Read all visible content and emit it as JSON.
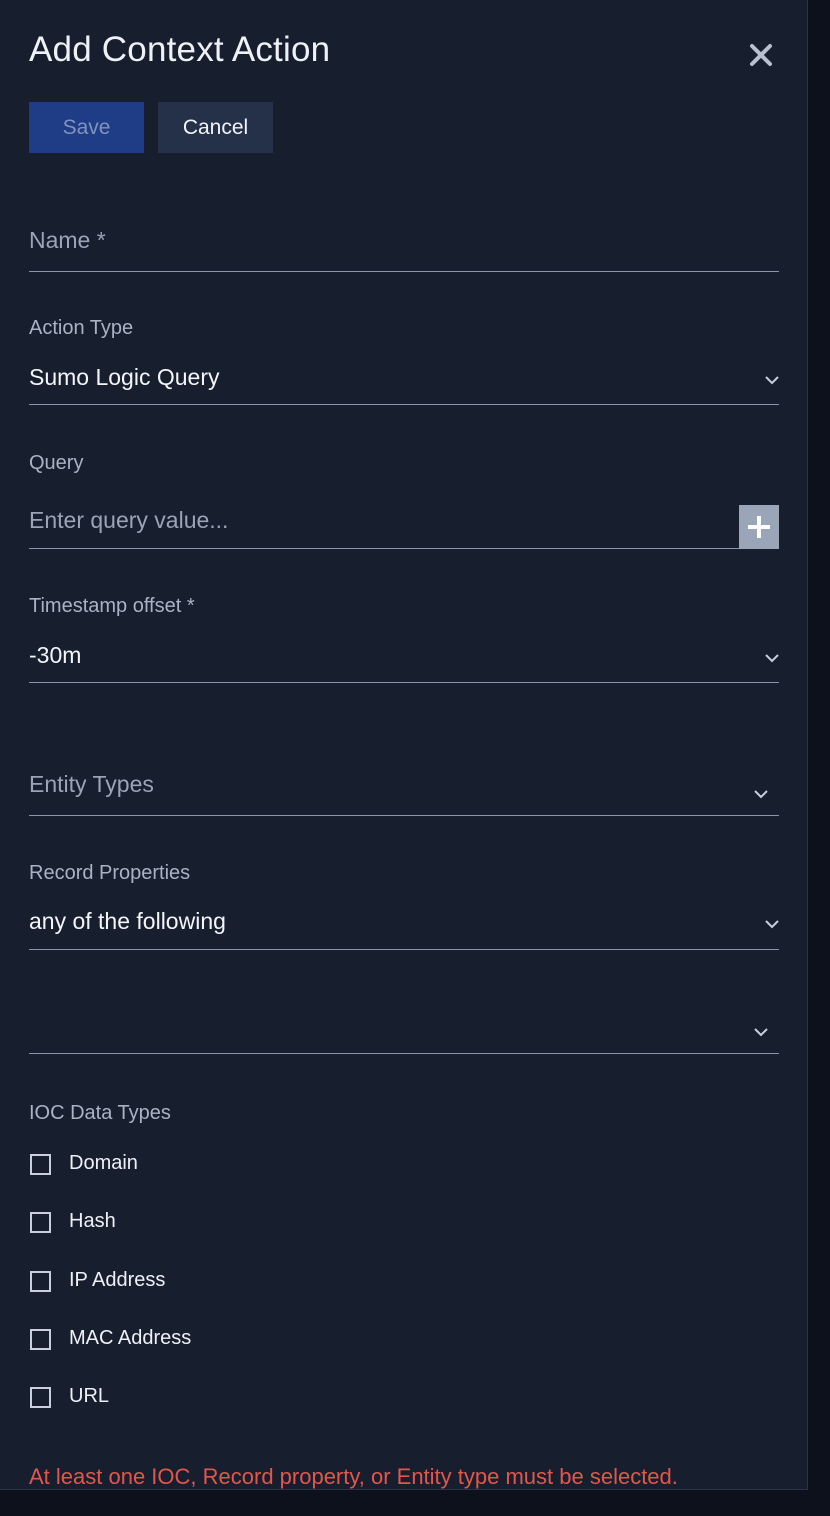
{
  "dialog": {
    "title": "Add Context Action",
    "close_icon": "close-icon"
  },
  "toolbar": {
    "save_label": "Save",
    "cancel_label": "Cancel"
  },
  "form": {
    "name": {
      "label": "Name *",
      "value": ""
    },
    "action_type": {
      "label": "Action Type",
      "value": "Sumo Logic Query"
    },
    "query": {
      "label": "Query",
      "placeholder": "Enter query value...",
      "value": "",
      "add_icon": "plus-icon"
    },
    "timestamp_offset": {
      "label": "Timestamp offset *",
      "value": "-30m"
    },
    "entity_types": {
      "placeholder": "Entity Types",
      "value": ""
    },
    "record_properties": {
      "label": "Record Properties",
      "value": "any of the following"
    },
    "record_properties_list": {
      "value": ""
    },
    "ioc_data_types": {
      "label": "IOC Data Types",
      "options": [
        {
          "label": "Domain",
          "checked": false
        },
        {
          "label": "Hash",
          "checked": false
        },
        {
          "label": "IP Address",
          "checked": false
        },
        {
          "label": "MAC Address",
          "checked": false
        },
        {
          "label": "URL",
          "checked": false
        }
      ]
    },
    "validation_error": "At least one IOC, Record property, or Entity type must be selected."
  },
  "colors": {
    "panel_background": "#171e2e",
    "save_button": "#1f3d86",
    "cancel_button": "#243149",
    "error": "#e2574c"
  }
}
